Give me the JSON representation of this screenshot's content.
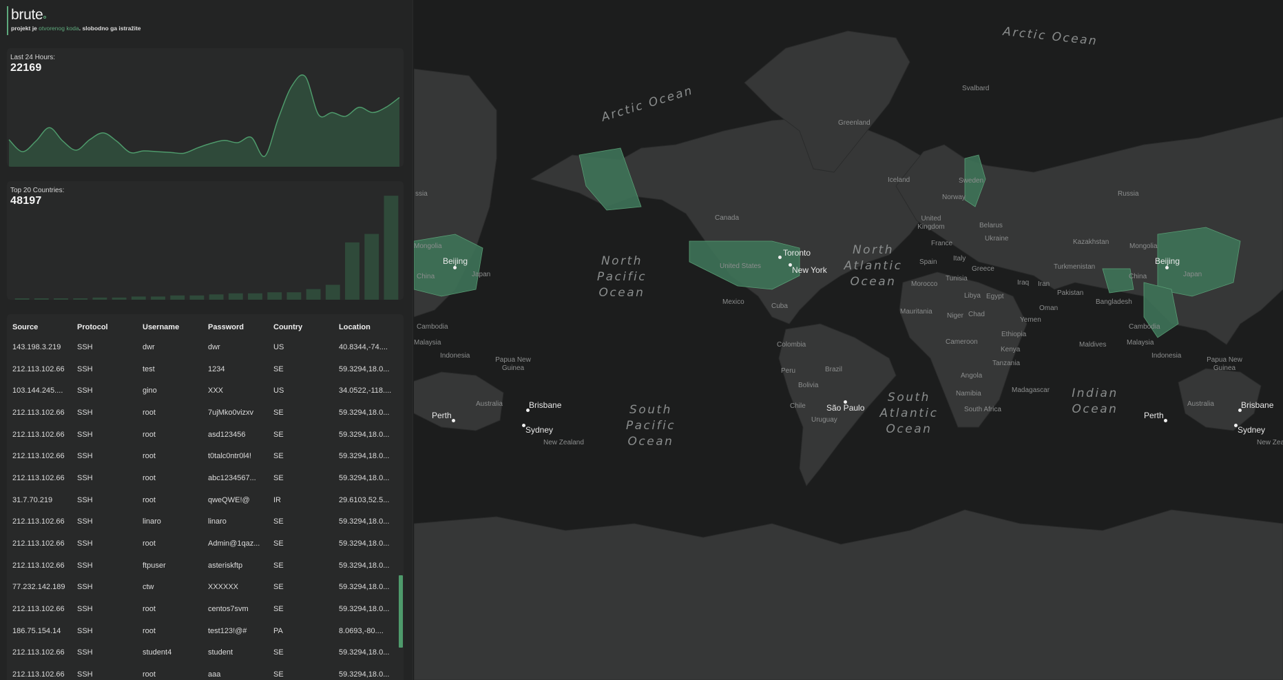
{
  "brand": {
    "title": "brute",
    "subtitle_pre": "projekt je ",
    "subtitle_link": "otvorenog koda",
    "subtitle_post": ". slobodno ga istražite"
  },
  "stats": {
    "last24": {
      "label": "Last 24 Hours:",
      "value": "22169"
    },
    "countries": {
      "label": "Top 20 Countries:",
      "value": "48197"
    }
  },
  "colors": {
    "accent": "#5ea97c",
    "chart_fill": "#2f4a3a",
    "chart_line": "#4e9a6b",
    "land": "#363737",
    "highlight": "#3e7358"
  },
  "chart_data": [
    {
      "type": "area",
      "title": "Last 24 Hours:",
      "x": [
        0,
        1,
        2,
        3,
        4,
        5,
        6,
        7,
        8,
        9,
        10,
        11,
        12,
        13,
        14,
        15,
        16,
        17,
        18,
        19,
        20,
        21,
        22,
        23,
        24,
        25,
        26,
        27,
        28,
        29
      ],
      "values": [
        36,
        20,
        34,
        52,
        34,
        22,
        36,
        45,
        34,
        19,
        21,
        20,
        19,
        18,
        25,
        31,
        35,
        32,
        39,
        14,
        64,
        107,
        120,
        69,
        72,
        67,
        79,
        72,
        79,
        92
      ],
      "ylim": [
        0,
        130
      ]
    },
    {
      "type": "bar",
      "title": "Top 20 Countries:",
      "values": [
        1,
        1,
        1,
        1,
        2,
        2,
        3,
        3,
        4,
        4,
        5,
        6,
        6,
        7,
        7,
        10,
        14,
        54,
        62,
        98
      ],
      "ylim": [
        0,
        100
      ]
    }
  ],
  "table": {
    "headers": [
      "Source",
      "Protocol",
      "Username",
      "Password",
      "Country",
      "Location"
    ],
    "rows": [
      [
        "143.198.3.219",
        "SSH",
        "dwr",
        "dwr",
        "US",
        "40.8344,-74...."
      ],
      [
        "212.113.102.66",
        "SSH",
        "test",
        "1234",
        "SE",
        "59.3294,18.0..."
      ],
      [
        "103.144.245....",
        "SSH",
        "gino",
        "XXX",
        "US",
        "34.0522,-118...."
      ],
      [
        "212.113.102.66",
        "SSH",
        "root",
        "7ujMko0vizxv",
        "SE",
        "59.3294,18.0..."
      ],
      [
        "212.113.102.66",
        "SSH",
        "root",
        "asd123456",
        "SE",
        "59.3294,18.0..."
      ],
      [
        "212.113.102.66",
        "SSH",
        "root",
        "t0talc0ntr0l4!",
        "SE",
        "59.3294,18.0..."
      ],
      [
        "212.113.102.66",
        "SSH",
        "root",
        "abc1234567...",
        "SE",
        "59.3294,18.0..."
      ],
      [
        "31.7.70.219",
        "SSH",
        "root",
        "qweQWE!@",
        "IR",
        "29.6103,52.5..."
      ],
      [
        "212.113.102.66",
        "SSH",
        "linaro",
        "linaro",
        "SE",
        "59.3294,18.0..."
      ],
      [
        "212.113.102.66",
        "SSH",
        "root",
        "Admin@1qaz...",
        "SE",
        "59.3294,18.0..."
      ],
      [
        "212.113.102.66",
        "SSH",
        "ftpuser",
        "asteriskftp",
        "SE",
        "59.3294,18.0..."
      ],
      [
        "77.232.142.189",
        "SSH",
        "ctw",
        "XXXXXX",
        "SE",
        "59.3294,18.0..."
      ],
      [
        "212.113.102.66",
        "SSH",
        "root",
        "centos7svm",
        "SE",
        "59.3294,18.0..."
      ],
      [
        "186.75.154.14",
        "SSH",
        "root",
        "test123!@#",
        "PA",
        "8.0693,-80...."
      ],
      [
        "212.113.102.66",
        "SSH",
        "student4",
        "student",
        "SE",
        "59.3294,18.0..."
      ],
      [
        "212.113.102.66",
        "SSH",
        "root",
        "aaa",
        "SE",
        "59.3294,18.0..."
      ]
    ]
  },
  "map": {
    "oceans": {
      "arctic_left": "Arctic Ocean",
      "arctic_right": "Arctic Ocean",
      "north_pacific": "North Pacific Ocean",
      "north_atlantic": "North Atlantic Ocean",
      "south_pacific": "South Pacific Ocean",
      "south_atlantic": "South Atlantic Ocean",
      "indian": "Indian Ocean"
    },
    "land": {
      "greenland": "Greenland",
      "svalbard": "Svalbard",
      "iceland": "Iceland",
      "russia_l": "ssia",
      "russia": "Russia",
      "canada": "Canada",
      "united_states": "United States",
      "mexico": "Mexico",
      "cuba": "Cuba",
      "colombia": "Colombia",
      "peru": "Peru",
      "bolivia": "Bolivia",
      "brazil": "Brazil",
      "chile": "Chile",
      "uruguay": "Uruguay",
      "norway": "Norway",
      "sweden": "Sweden",
      "uk": "United Kingdom",
      "france": "France",
      "spain": "Spain",
      "italy": "Italy",
      "belarus": "Belarus",
      "ukraine": "Ukraine",
      "greece": "Greece",
      "morocco": "Morocco",
      "tunisia": "Tunisia",
      "libya": "Libya",
      "egypt": "Egypt",
      "mauritania": "Mauritania",
      "niger": "Niger",
      "chad": "Chad",
      "ethiopia": "Ethiopia",
      "cameroon": "Cameroon",
      "kenya": "Kenya",
      "tanzania": "Tanzania",
      "angola": "Angola",
      "namibia": "Namibia",
      "south_africa": "South Africa",
      "madagascar": "Madagascar",
      "yemen": "Yemen",
      "oman": "Oman",
      "iraq": "Iraq",
      "iran": "Iran",
      "pakistan": "Pakistan",
      "turkmenistan": "Turkmenistan",
      "kazakhstan": "Kazakhstan",
      "mongolia_r": "Mongolia",
      "mongolia_l": "Mongolia",
      "china_r": "China",
      "china_l": "China",
      "japan_r": "Japan",
      "japan_l": "Japan",
      "bangladesh": "Bangladesh",
      "cambodia_r": "Cambodia",
      "cambodia_l": "Cambodia",
      "malaysia_r": "Malaysia",
      "malaysia_l": "Malaysia",
      "indonesia_r": "Indonesia",
      "indonesia_l": "Indonesia",
      "maldives": "Maldives",
      "png_l": "Papua New Guinea",
      "png_r": "Papua New Guinea",
      "australia_l": "Australia",
      "australia_r": "Australia",
      "nz_l": "New Zealand",
      "nz_r": "New Zea"
    },
    "cities": {
      "toronto": "Toronto",
      "new_york": "New York",
      "sao_paulo": "São Paulo",
      "beijing_l": "Beijing",
      "beijing_r": "Beijing",
      "perth_l": "Perth",
      "perth_r": "Perth",
      "brisbane_l": "Brisbane",
      "brisbane_r": "Brisbane",
      "sydney_l": "Sydney",
      "sydney_r": "Sydney"
    }
  }
}
